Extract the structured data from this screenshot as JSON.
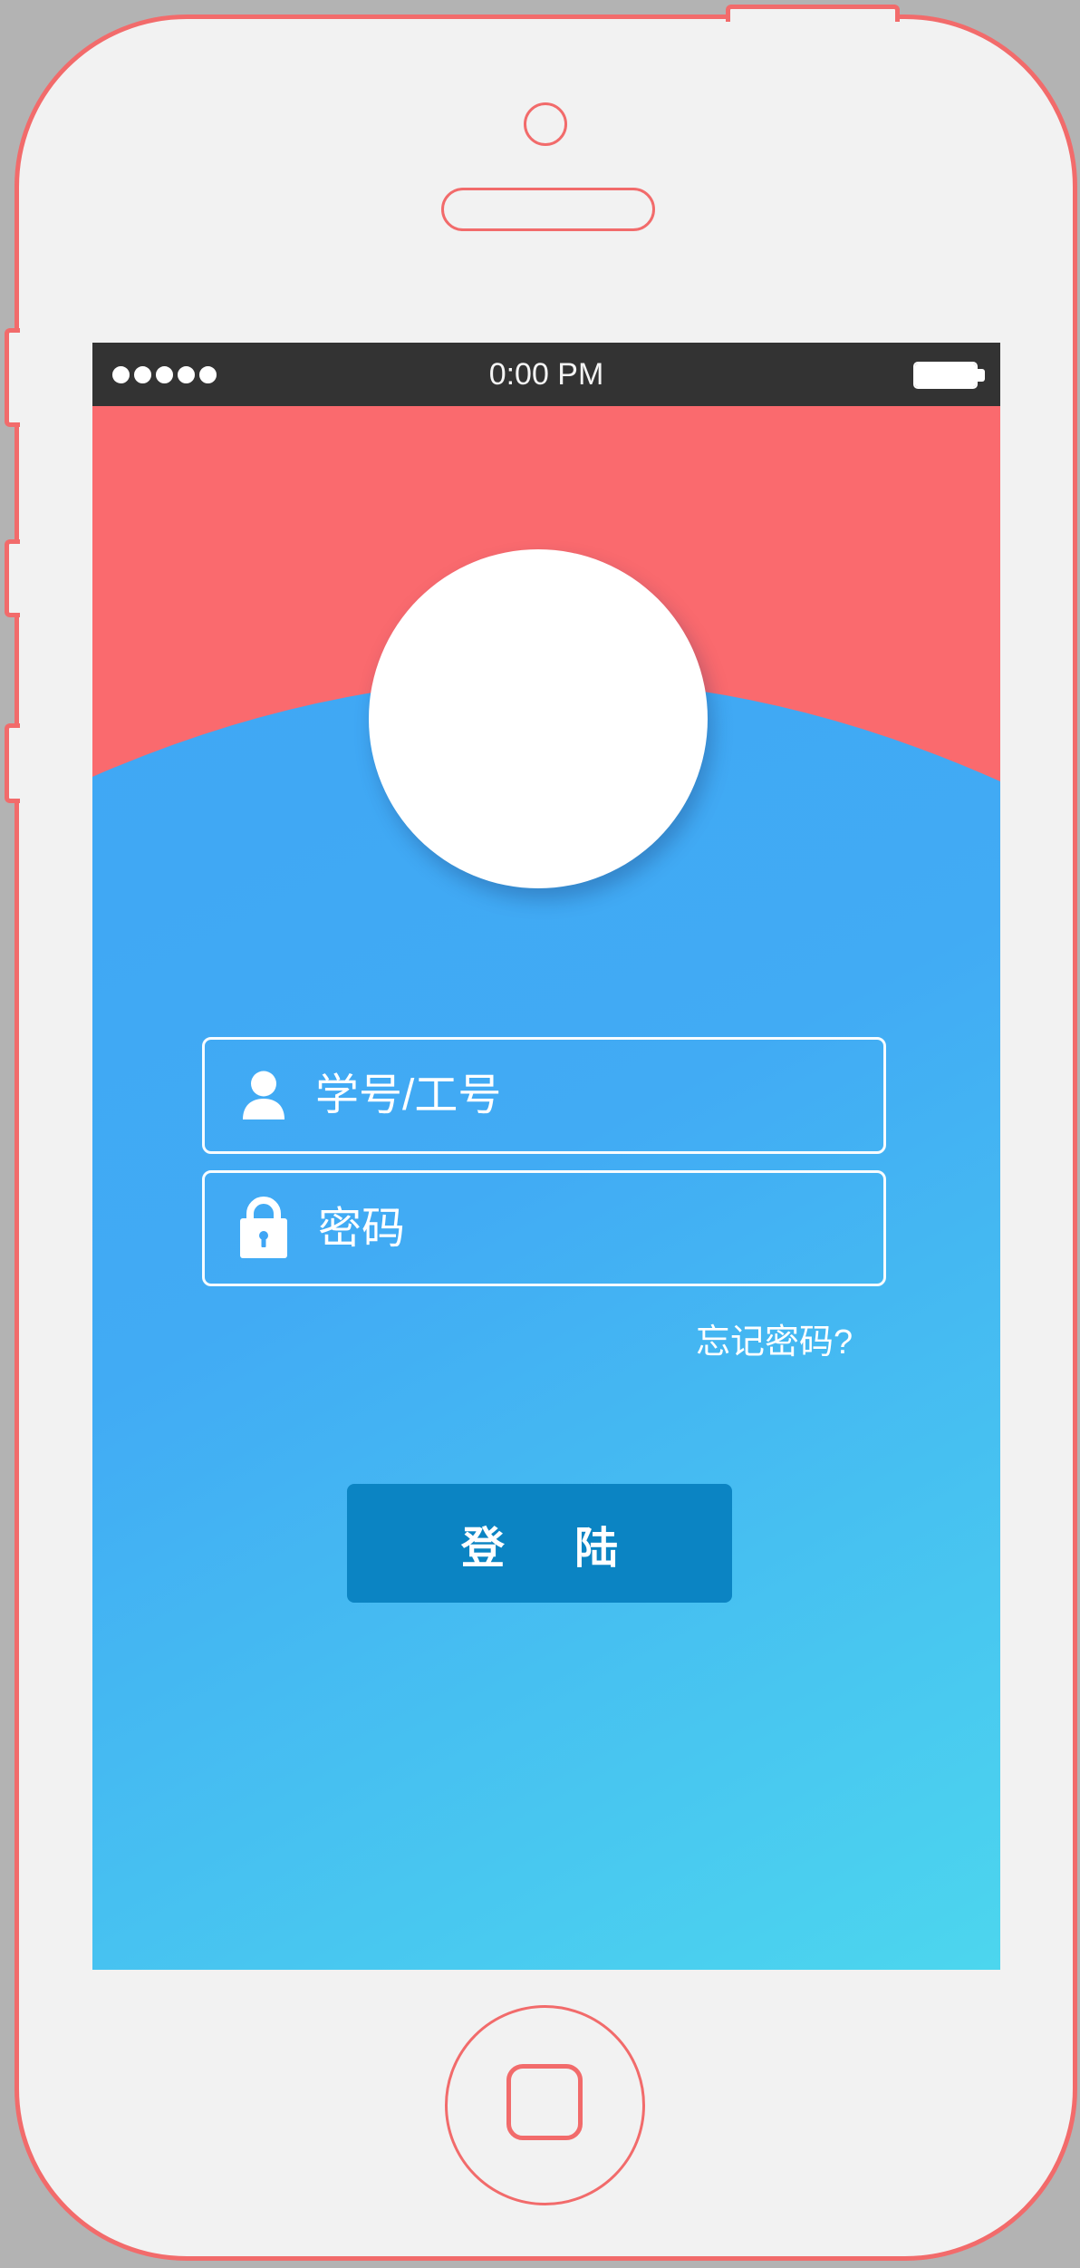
{
  "status_bar": {
    "time": "0:00 PM",
    "signal_icon": "signal-dots",
    "signal_level": 5,
    "signal_max": 5,
    "battery_icon": "battery-icon",
    "battery_level": 1.0
  },
  "header": {
    "avatar_icon": "avatar-placeholder"
  },
  "login_form": {
    "username": {
      "icon": "user-icon",
      "placeholder": "学号/工号",
      "value": ""
    },
    "password": {
      "icon": "lock-icon",
      "placeholder": "密码",
      "value": ""
    },
    "forgot_password_label": "忘记密码?",
    "login_button_label": "登 陆"
  },
  "device": {
    "home_button_icon": "home-square-icon"
  },
  "colors": {
    "backdrop": "#b3b3b3",
    "device_body": "#f2f2f2",
    "device_outline": "#f26b6b",
    "status_bar": "#333333",
    "header_red": "#fa6a6e",
    "gradient_start": "#3fa5f5",
    "gradient_mid": "#41abf4",
    "gradient_end": "#4cd6ee",
    "button_blue": "#0b84c3",
    "text": "#ffffff"
  }
}
